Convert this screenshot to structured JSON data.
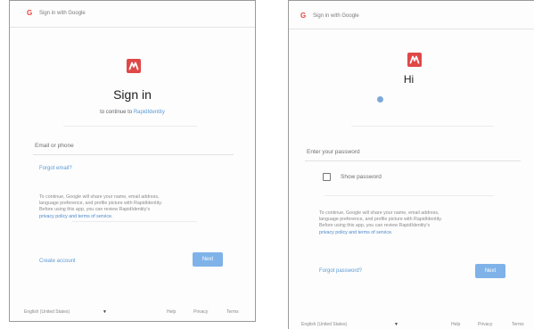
{
  "left": {
    "header_text": "Sign in with Google",
    "title": "Sign in",
    "subtitle_prefix": "to continue to",
    "subtitle_app": "RapidIdentity",
    "email_placeholder": "Email or phone",
    "forgot_email": "Forgot email?",
    "disclaimer_lines": [
      "To continue, Google will share your name, email address,",
      "language preference, and profile picture with RapidIdentity.",
      "Before using this app, you can review RapidIdentity's"
    ],
    "disclaimer_links": "privacy policy and terms of service.",
    "create_account": "Create account",
    "next": "Next",
    "footer_language": "English (United States)",
    "footer_help": "Help",
    "footer_privacy": "Privacy",
    "footer_terms": "Terms"
  },
  "right": {
    "header_text": "Sign in with Google",
    "title": "Hi",
    "password_placeholder": "Enter your password",
    "show_password": "Show password",
    "disclaimer_lines": [
      "To continue, Google will share your name, email address,",
      "language preference, and profile picture with RapidIdentity.",
      "Before using this app, you can review RapidIdentity's"
    ],
    "disclaimer_links": "privacy policy and terms of service.",
    "forgot_password": "Forgot password?",
    "next": "Next",
    "footer_language": "English (United States)",
    "footer_help": "Help",
    "footer_privacy": "Privacy",
    "footer_terms": "Terms"
  },
  "icons": {
    "google": "google-g-icon",
    "app_logo": "rapididentity-logo-icon",
    "dropdown": "caret-down-icon",
    "checkbox": "checkbox-icon",
    "avatar": "account-avatar-icon"
  },
  "colors": {
    "accent_link": "#5b9bd5",
    "next_button": "#7fb2e8",
    "logo_red": "#e04848",
    "google_red": "#e8453c"
  }
}
